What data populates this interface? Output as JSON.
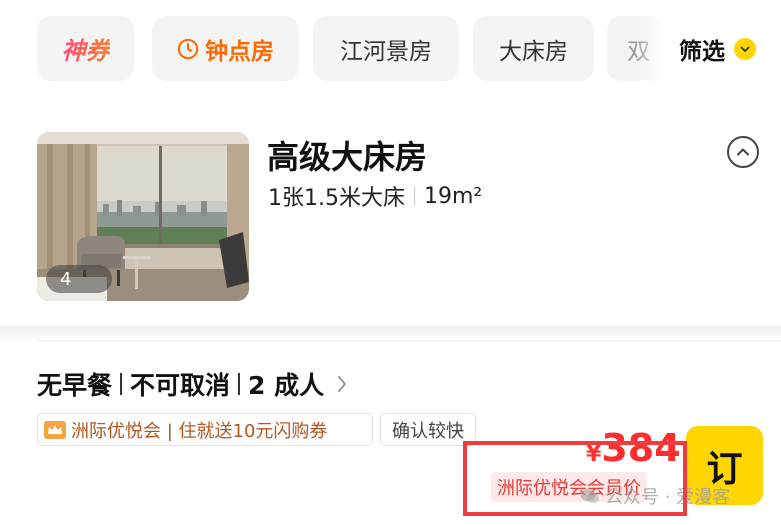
{
  "filter_chips": {
    "deal": "神券",
    "hourly": "钟点房",
    "river_view": "江河景房",
    "king_bed": "大床房",
    "more": "双",
    "filter_label": "筛选"
  },
  "room": {
    "title": "高级大床房",
    "bed": "1张1.5米大床",
    "area": "19m²",
    "photo_count": "4"
  },
  "rate_plan": {
    "breakfast": "无早餐",
    "cancellation": "不可取消",
    "occupancy": "2 成人",
    "member_tag": "洲际优悦会 | 住就送10元闪购券",
    "confirm_tag": "确认较快",
    "currency": "¥",
    "price": "384",
    "member_price_label": "洲际优悦会会员价",
    "book_label": "订"
  },
  "watermark": "公众号 · 爱漫客",
  "colors": {
    "accent_yellow": "#ffd600",
    "price_red": "#ff2d2d",
    "hourly_orange": "#ff6a00",
    "highlight_red": "#f03c3c"
  },
  "icons": {
    "hourly": "clock-icon",
    "filter": "chevron-down-icon",
    "collapse": "chevron-up-icon",
    "policy": "chevron-right-icon",
    "member": "crown-icon"
  }
}
